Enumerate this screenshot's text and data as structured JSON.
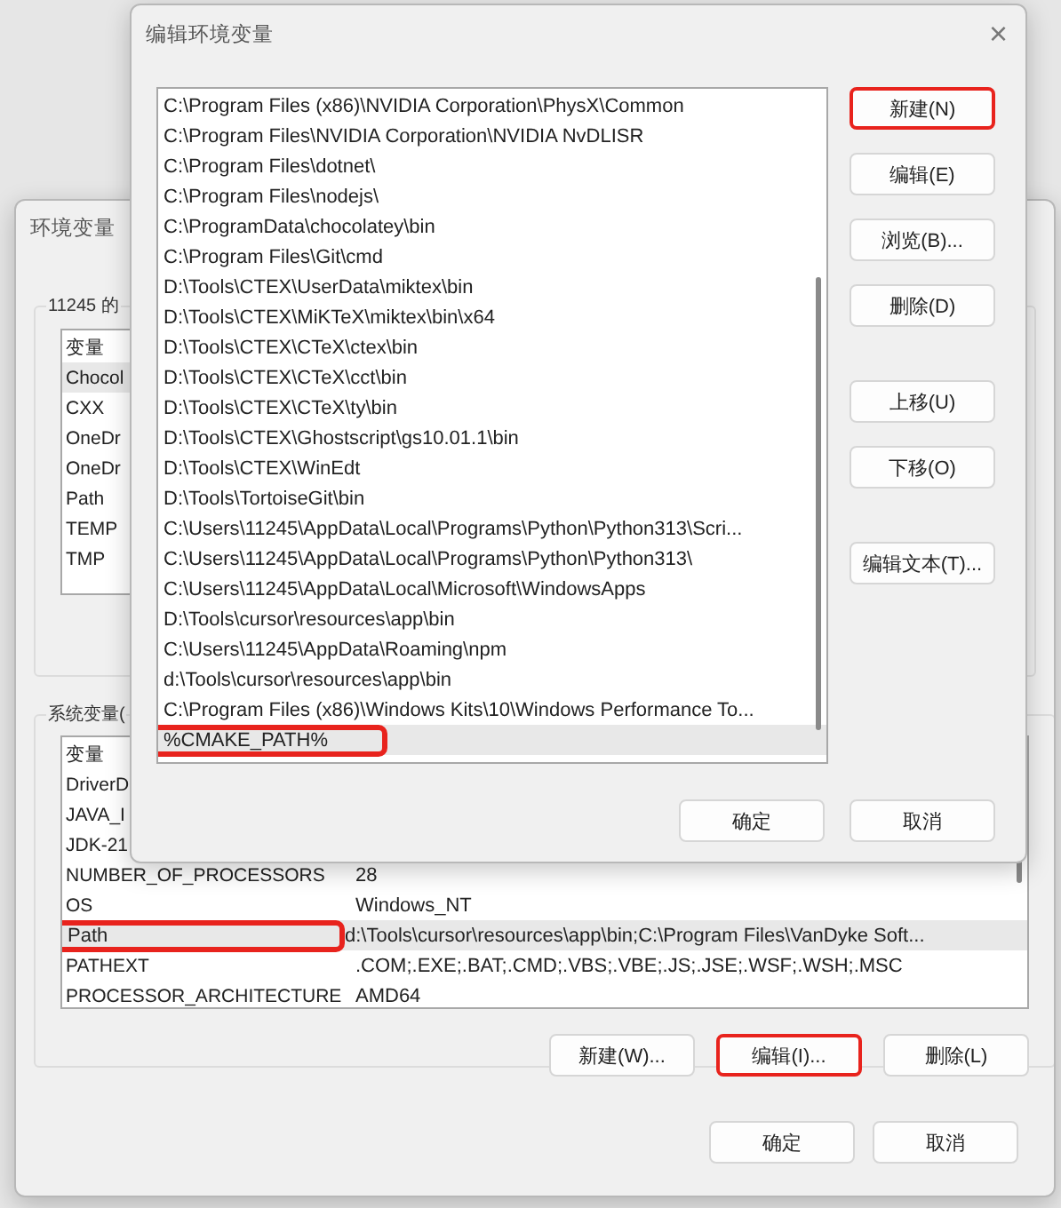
{
  "env_window": {
    "title": "环境变量",
    "user_group": {
      "title": "11245 的",
      "columns": [
        "变量"
      ],
      "rows": [
        {
          "name": "Chocol",
          "selected": true
        },
        {
          "name": "CXX",
          "selected": false
        },
        {
          "name": "OneDr",
          "selected": false
        },
        {
          "name": "OneDr",
          "selected": false
        },
        {
          "name": "Path",
          "selected": false
        },
        {
          "name": "TEMP",
          "selected": false
        },
        {
          "name": "TMP",
          "selected": false
        }
      ]
    },
    "system_group": {
      "title": "系统变量(",
      "columns": [
        "变量"
      ],
      "rows": [
        {
          "name": "DriverD",
          "selected": false,
          "highlighted": false
        },
        {
          "name": "JAVA_I",
          "selected": false,
          "highlighted": false
        },
        {
          "name": "JDK-21",
          "selected": false,
          "highlighted": false
        },
        {
          "name": "NUMBER_OF_PROCESSORS",
          "value": "28",
          "selected": false,
          "highlighted": false
        },
        {
          "name": "OS",
          "value": "Windows_NT",
          "selected": false,
          "highlighted": false
        },
        {
          "name": "Path",
          "value": "d:\\Tools\\cursor\\resources\\app\\bin;C:\\Program Files\\VanDyke Soft...",
          "selected": true,
          "highlighted": true
        },
        {
          "name": "PATHEXT",
          "value": ".COM;.EXE;.BAT;.CMD;.VBS;.VBE;.JS;.JSE;.WSF;.WSH;.MSC",
          "selected": false,
          "highlighted": false
        },
        {
          "name": "PROCESSOR_ARCHITECTURE",
          "value": "AMD64",
          "selected": false,
          "highlighted": false
        }
      ],
      "buttons": [
        {
          "label": "新建(W)...",
          "highlighted": false
        },
        {
          "label": "编辑(I)...",
          "highlighted": true
        },
        {
          "label": "删除(L)",
          "highlighted": false
        }
      ]
    },
    "footer_buttons": [
      "确定",
      "取消"
    ]
  },
  "edit_window": {
    "title": "编辑环境变量",
    "close": "×",
    "entries": [
      {
        "text": "C:\\Program Files (x86)\\NVIDIA Corporation\\PhysX\\Common",
        "selected": false,
        "highlighted": false
      },
      {
        "text": "C:\\Program Files\\NVIDIA Corporation\\NVIDIA NvDLISR",
        "selected": false,
        "highlighted": false
      },
      {
        "text": "C:\\Program Files\\dotnet\\",
        "selected": false,
        "highlighted": false
      },
      {
        "text": "C:\\Program Files\\nodejs\\",
        "selected": false,
        "highlighted": false
      },
      {
        "text": "C:\\ProgramData\\chocolatey\\bin",
        "selected": false,
        "highlighted": false
      },
      {
        "text": "C:\\Program Files\\Git\\cmd",
        "selected": false,
        "highlighted": false
      },
      {
        "text": "D:\\Tools\\CTEX\\UserData\\miktex\\bin",
        "selected": false,
        "highlighted": false
      },
      {
        "text": "D:\\Tools\\CTEX\\MiKTeX\\miktex\\bin\\x64",
        "selected": false,
        "highlighted": false
      },
      {
        "text": "D:\\Tools\\CTEX\\CTeX\\ctex\\bin",
        "selected": false,
        "highlighted": false
      },
      {
        "text": "D:\\Tools\\CTEX\\CTeX\\cct\\bin",
        "selected": false,
        "highlighted": false
      },
      {
        "text": "D:\\Tools\\CTEX\\CTeX\\ty\\bin",
        "selected": false,
        "highlighted": false
      },
      {
        "text": "D:\\Tools\\CTEX\\Ghostscript\\gs10.01.1\\bin",
        "selected": false,
        "highlighted": false
      },
      {
        "text": "D:\\Tools\\CTEX\\WinEdt",
        "selected": false,
        "highlighted": false
      },
      {
        "text": "D:\\Tools\\TortoiseGit\\bin",
        "selected": false,
        "highlighted": false
      },
      {
        "text": "C:\\Users\\11245\\AppData\\Local\\Programs\\Python\\Python313\\Scri...",
        "selected": false,
        "highlighted": false
      },
      {
        "text": "C:\\Users\\11245\\AppData\\Local\\Programs\\Python\\Python313\\",
        "selected": false,
        "highlighted": false
      },
      {
        "text": "C:\\Users\\11245\\AppData\\Local\\Microsoft\\WindowsApps",
        "selected": false,
        "highlighted": false
      },
      {
        "text": "D:\\Tools\\cursor\\resources\\app\\bin",
        "selected": false,
        "highlighted": false
      },
      {
        "text": "C:\\Users\\11245\\AppData\\Roaming\\npm",
        "selected": false,
        "highlighted": false
      },
      {
        "text": "d:\\Tools\\cursor\\resources\\app\\bin",
        "selected": false,
        "highlighted": false
      },
      {
        "text": "C:\\Program Files (x86)\\Windows Kits\\10\\Windows Performance To...",
        "selected": false,
        "highlighted": false
      },
      {
        "text": "%CMAKE_PATH%",
        "selected": true,
        "highlighted": true
      }
    ],
    "side_button_groups": [
      [
        {
          "label": "新建(N)",
          "highlighted": true
        },
        {
          "label": "编辑(E)",
          "highlighted": false
        },
        {
          "label": "浏览(B)...",
          "highlighted": false
        },
        {
          "label": "删除(D)",
          "highlighted": false
        }
      ],
      [
        {
          "label": "上移(U)",
          "highlighted": false
        },
        {
          "label": "下移(O)",
          "highlighted": false
        }
      ],
      [
        {
          "label": "编辑文本(T)...",
          "highlighted": false
        }
      ]
    ],
    "footer_buttons": [
      "确定",
      "取消"
    ]
  }
}
